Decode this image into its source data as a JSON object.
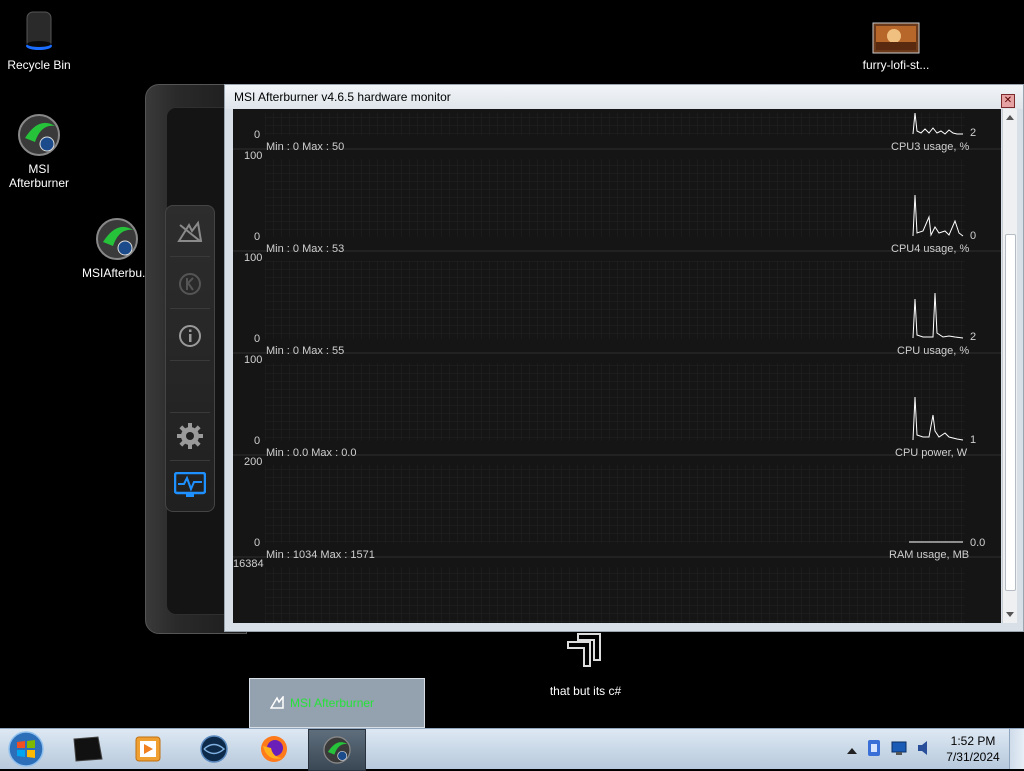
{
  "desktop": {
    "icons": [
      {
        "label": "Recycle Bin",
        "icon": "recycle-bin-icon"
      },
      {
        "label": "MSI\nAfterburner",
        "icon": "afterburner-icon"
      },
      {
        "label": "MSIAfterbu...",
        "icon": "afterburner-icon"
      },
      {
        "label": "furry-lofi-st...",
        "icon": "image-file-icon"
      }
    ],
    "note_label": "that but its c#"
  },
  "monitor": {
    "title": "MSI Afterburner v4.6.5 hardware monitor",
    "close_label": "✕",
    "graphs": [
      {
        "name": "CPU3 usage, %",
        "top": "",
        "bottom": "0",
        "minmax": "Min : 0   Max : 50",
        "current": "2"
      },
      {
        "name": "CPU4 usage, %",
        "top": "100",
        "bottom": "0",
        "minmax": "Min : 0   Max : 53",
        "current": "0"
      },
      {
        "name": "CPU usage, %",
        "top": "100",
        "bottom": "0",
        "minmax": "Min : 0   Max : 55",
        "current": "2"
      },
      {
        "name": "CPU power, W",
        "top": "100",
        "bottom": "0",
        "minmax": "Min : 0.0   Max : 0.0",
        "current": "1"
      },
      {
        "name": "RAM usage, MB",
        "top": "200",
        "bottom": "0",
        "minmax": "Min : 1034   Max : 1571",
        "current": "0.0"
      },
      {
        "name": "",
        "top": "16384",
        "bottom": "",
        "minmax": "",
        "current": ""
      }
    ]
  },
  "taskbar": {
    "preview_label": "MSI Afterburner",
    "clock_time": "1:52 PM",
    "clock_date": "7/31/2024",
    "apps": [
      "afterburner-skin-icon",
      "media-player-icon",
      "browser-icon",
      "firefox-icon",
      "afterburner-icon"
    ]
  },
  "colors": {
    "graph_bg": "#151515",
    "grid": "#2a2a2a",
    "trace": "#ffffff",
    "preview_text": "#26e23a"
  }
}
